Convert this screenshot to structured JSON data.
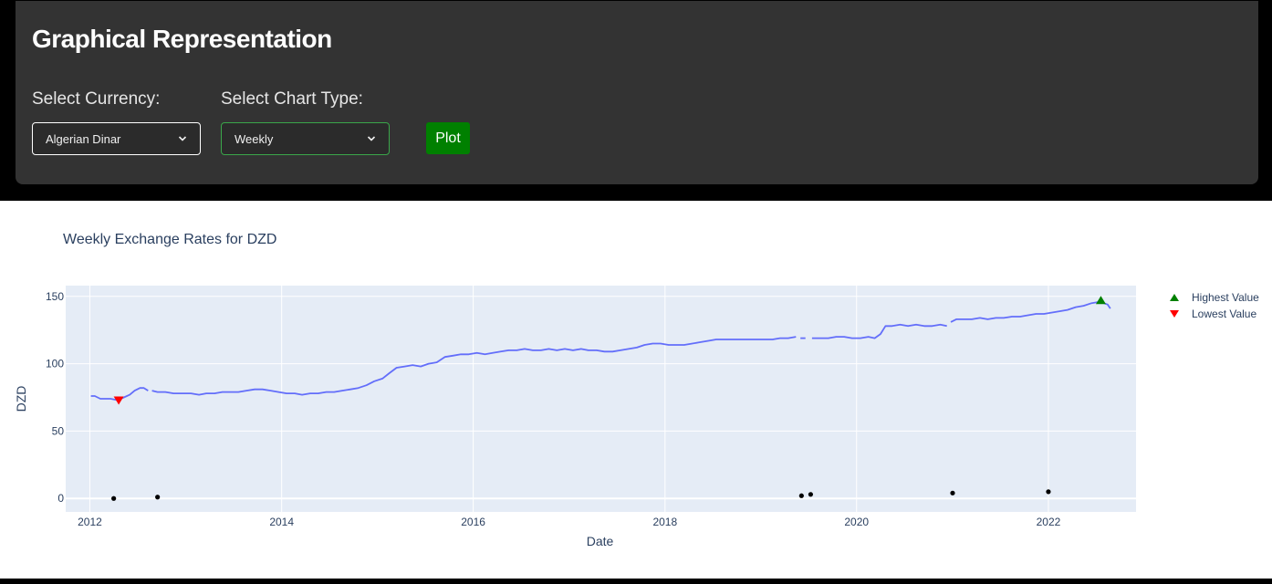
{
  "header": {
    "title": "Graphical Representation",
    "currency_label": "Select Currency:",
    "currency_value": "Algerian Dinar",
    "chart_type_label": "Select Chart Type:",
    "chart_type_value": "Weekly",
    "plot_label": "Plot"
  },
  "colors": {
    "panel_bg": "#333333",
    "line": "#636efa",
    "plot_bg": "#e5ecf6",
    "highest_marker": "#008000",
    "lowest_marker": "#ff0000",
    "text": "#2a3f5f"
  },
  "chart_data": {
    "type": "line",
    "title": "Weekly Exchange Rates for DZD",
    "xlabel": "Date",
    "ylabel": "DZD",
    "xlim": [
      "2011-10-01",
      "2022-12-01"
    ],
    "ylim": [
      -10,
      158
    ],
    "xticks": [
      "2012",
      "2014",
      "2016",
      "2018",
      "2020",
      "2022"
    ],
    "yticks": [
      0,
      50,
      100,
      150
    ],
    "grid": true,
    "legend_position": "top-right",
    "series": [
      {
        "type": "line",
        "color": "#636efa",
        "segments": [
          {
            "x": [
              "2012-01-05",
              "2012-01-20",
              "2012-02-10",
              "2012-03-01",
              "2012-03-20",
              "2012-04-15",
              "2012-05-10",
              "2012-06-01",
              "2012-06-20",
              "2012-07-10",
              "2012-07-25",
              "2012-08-10"
            ],
            "y": [
              76,
              76,
              74,
              74,
              74,
              73,
              75,
              77,
              80,
              82,
              82,
              80
            ]
          },
          {
            "x": [
              "2012-08-25",
              "2012-09-15",
              "2012-10-15",
              "2012-11-15",
              "2012-12-20",
              "2013-01-20",
              "2013-02-20",
              "2013-03-20",
              "2013-04-20",
              "2013-05-20",
              "2013-06-20",
              "2013-07-20",
              "2013-08-20",
              "2013-09-20",
              "2013-10-20",
              "2013-11-20",
              "2013-12-20",
              "2014-01-20",
              "2014-02-20",
              "2014-03-20",
              "2014-04-20",
              "2014-05-20",
              "2014-06-20",
              "2014-07-20",
              "2014-08-20",
              "2014-09-20",
              "2014-10-20",
              "2014-11-20",
              "2014-12-20",
              "2015-01-20",
              "2015-02-15",
              "2015-03-15",
              "2015-04-15",
              "2015-05-15",
              "2015-06-15",
              "2015-07-15",
              "2015-08-15",
              "2015-09-15",
              "2015-10-15",
              "2015-11-15",
              "2015-12-15",
              "2016-01-15",
              "2016-02-15",
              "2016-03-15",
              "2016-04-15",
              "2016-05-15",
              "2016-06-15",
              "2016-07-15",
              "2016-08-15",
              "2016-09-15",
              "2016-10-15",
              "2016-11-15",
              "2016-12-15",
              "2017-01-15",
              "2017-02-15",
              "2017-03-15",
              "2017-04-15",
              "2017-05-15",
              "2017-06-15",
              "2017-07-15",
              "2017-08-15",
              "2017-09-15",
              "2017-10-15",
              "2017-11-15",
              "2017-12-15",
              "2018-01-15",
              "2018-02-15",
              "2018-03-15",
              "2018-04-15",
              "2018-05-15",
              "2018-06-15",
              "2018-07-15",
              "2018-08-15",
              "2018-09-15",
              "2018-10-15",
              "2018-11-15",
              "2018-12-15",
              "2019-01-15",
              "2019-02-15",
              "2019-03-15",
              "2019-04-15",
              "2019-05-15"
            ],
            "y": [
              80,
              79,
              79,
              78,
              78,
              78,
              77,
              78,
              78,
              79,
              79,
              79,
              80,
              81,
              81,
              80,
              79,
              78,
              78,
              77,
              78,
              78,
              79,
              79,
              80,
              81,
              82,
              84,
              87,
              89,
              93,
              97,
              98,
              99,
              98,
              100,
              101,
              105,
              106,
              107,
              107,
              108,
              107,
              108,
              109,
              110,
              110,
              111,
              110,
              110,
              111,
              110,
              111,
              110,
              111,
              110,
              110,
              109,
              109,
              110,
              111,
              112,
              114,
              115,
              115,
              114,
              114,
              114,
              115,
              116,
              117,
              118,
              118,
              118,
              118,
              118,
              118,
              118,
              118,
              119,
              119,
              120
            ]
          },
          {
            "x": [
              "2019-06-01",
              "2019-06-20"
            ],
            "y": [
              119,
              119
            ]
          },
          {
            "x": [
              "2019-07-15",
              "2019-08-15",
              "2019-09-15",
              "2019-10-15",
              "2019-11-15",
              "2019-12-15",
              "2020-01-15",
              "2020-02-15",
              "2020-03-10",
              "2020-04-01",
              "2020-04-20",
              "2020-05-15",
              "2020-06-15",
              "2020-07-15",
              "2020-08-15",
              "2020-09-15",
              "2020-10-15",
              "2020-11-15",
              "2020-12-10"
            ],
            "y": [
              119,
              119,
              119,
              120,
              120,
              119,
              119,
              120,
              119,
              122,
              128,
              128,
              129,
              128,
              129,
              128,
              128,
              129,
              128
            ]
          },
          {
            "x": [
              "2020-12-25",
              "2021-01-15",
              "2021-02-15",
              "2021-03-15",
              "2021-04-15",
              "2021-05-15",
              "2021-06-15",
              "2021-07-15",
              "2021-08-15",
              "2021-09-15",
              "2021-10-15",
              "2021-11-15",
              "2021-12-15",
              "2022-01-15",
              "2022-02-15",
              "2022-03-15",
              "2022-04-15",
              "2022-05-15",
              "2022-06-15",
              "2022-07-15",
              "2022-08-15",
              "2022-08-25"
            ],
            "y": [
              131,
              133,
              133,
              133,
              134,
              133,
              134,
              134,
              135,
              135,
              136,
              137,
              137,
              138,
              139,
              140,
              142,
              143,
              145,
              146,
              144,
              141
            ]
          }
        ]
      },
      {
        "type": "scatter",
        "color": "#000000",
        "x": [
          "2012-04-01",
          "2012-09-15",
          "2019-06-05",
          "2019-07-10",
          "2021-01-01",
          "2022-01-01"
        ],
        "y": [
          0,
          1,
          2,
          3,
          4,
          5
        ]
      },
      {
        "type": "marker",
        "name": "Highest Value",
        "symbol": "triangle-up",
        "color": "#008000",
        "x": [
          "2022-07-20"
        ],
        "y": [
          147
        ]
      },
      {
        "type": "marker",
        "name": "Lowest Value",
        "symbol": "triangle-down",
        "color": "#ff0000",
        "x": [
          "2012-04-20"
        ],
        "y": [
          73
        ]
      }
    ]
  }
}
